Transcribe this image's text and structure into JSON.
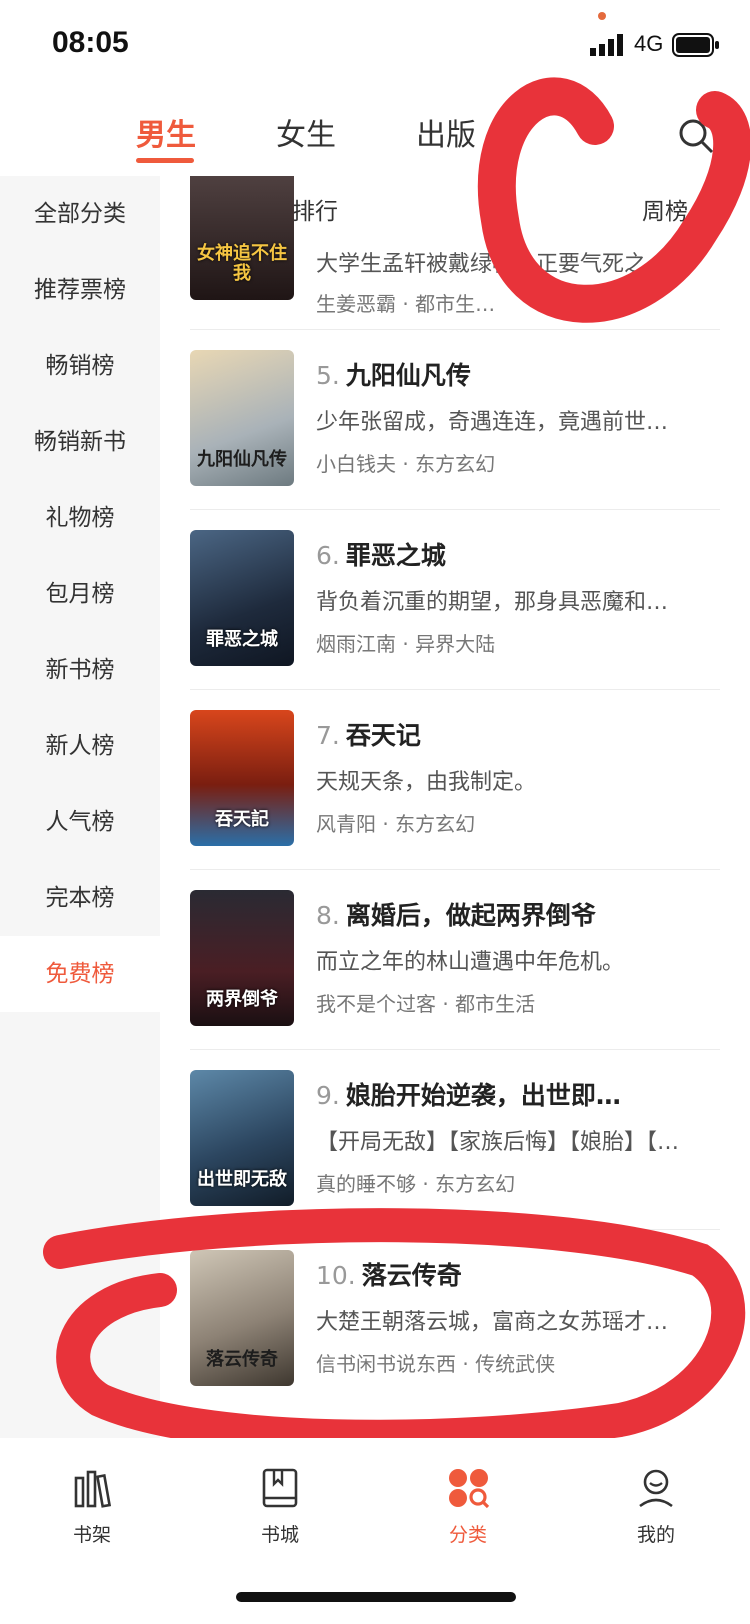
{
  "status": {
    "time": "08:05",
    "network": "4G"
  },
  "top_tabs": [
    {
      "label": "男生"
    },
    {
      "label": "女生"
    },
    {
      "label": "出版"
    }
  ],
  "sidebar": {
    "items": [
      {
        "label": "全部分类"
      },
      {
        "label": "推荐票榜"
      },
      {
        "label": "畅销榜"
      },
      {
        "label": "畅销新书"
      },
      {
        "label": "礼物榜"
      },
      {
        "label": "包月榜"
      },
      {
        "label": "新书榜"
      },
      {
        "label": "新人榜"
      },
      {
        "label": "人气榜"
      },
      {
        "label": "完本榜"
      },
      {
        "label": "免费榜"
      }
    ],
    "active_index": 10
  },
  "ranking": {
    "title": "免费作品排行",
    "period": "周榜"
  },
  "books": [
    {
      "rank": "",
      "name": "",
      "desc": "大学生孟轩被戴绿帽，正要气死之…",
      "author": "生姜恶霸",
      "genre": "都市生…",
      "cover_text": "女神追不住我",
      "cover_color": "#2a1f1f"
    },
    {
      "rank": "5.",
      "name": "九阳仙凡传",
      "desc": "少年张留成，奇遇连连，竟遇前世…",
      "author": "小白钱夫",
      "genre": "东方玄幻",
      "cover_text": "九阳仙凡传",
      "cover_color": "#d8c9a8"
    },
    {
      "rank": "6.",
      "name": "罪恶之城",
      "desc": "背负着沉重的期望，那身具恶魔和…",
      "author": "烟雨江南",
      "genre": "异界大陆",
      "cover_text": "罪恶之城",
      "cover_color": "#24344a"
    },
    {
      "rank": "7.",
      "name": "吞天记",
      "desc": "天规天条，由我制定。",
      "author": "风青阳",
      "genre": "东方玄幻",
      "cover_text": "吞天記",
      "cover_color": "#b8401e"
    },
    {
      "rank": "8.",
      "name": "离婚后，做起两界倒爷",
      "desc": "而立之年的林山遭遇中年危机。",
      "author": "我不是个过客",
      "genre": "都市生活",
      "cover_text": "两界倒爷",
      "cover_color": "#3a1a1e"
    },
    {
      "rank": "9.",
      "name": "娘胎开始逆袭，出世即…",
      "desc": "【开局无敌】【家族后悔】【娘胎】【师…",
      "author": "真的睡不够",
      "genre": "东方玄幻",
      "cover_text": "出世即无敌",
      "cover_color": "#2c4660"
    },
    {
      "rank": "10.",
      "name": "落云传奇",
      "desc": "大楚王朝落云城，富商之女苏瑶才…",
      "author": "信书闲书说东西",
      "genre": "传统武侠",
      "cover_text": "落云传奇",
      "cover_color": "#8d8275"
    }
  ],
  "bottom_nav": [
    {
      "label": "书架",
      "icon": "bookshelf-icon"
    },
    {
      "label": "书城",
      "icon": "book-icon"
    },
    {
      "label": "分类",
      "icon": "category-icon"
    },
    {
      "label": "我的",
      "icon": "profile-icon"
    }
  ],
  "colors": {
    "accent": "#ef5a3c",
    "annotation": "#e8333a"
  }
}
